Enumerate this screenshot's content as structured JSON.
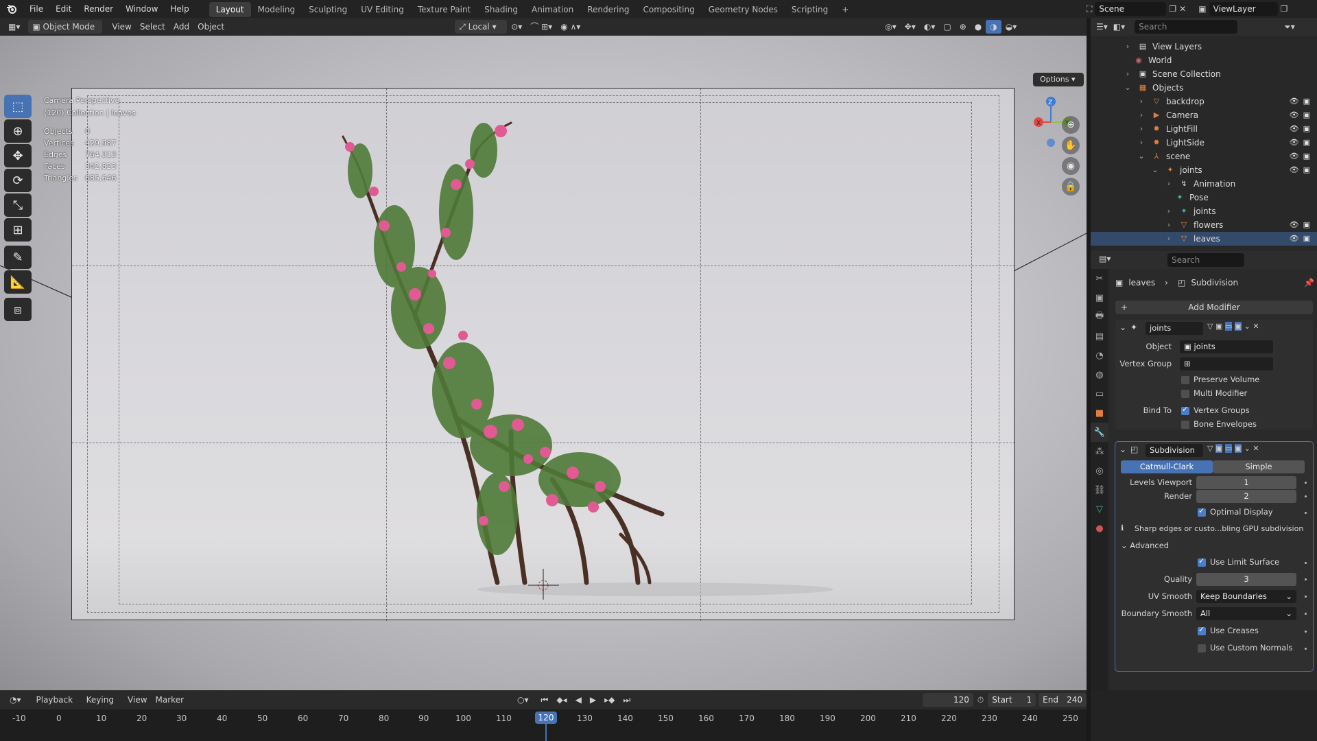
{
  "topbar": {
    "menus": [
      "File",
      "Edit",
      "Render",
      "Window",
      "Help"
    ],
    "workspaces": [
      "Layout",
      "Modeling",
      "Sculpting",
      "UV Editing",
      "Texture Paint",
      "Shading",
      "Animation",
      "Rendering",
      "Compositing",
      "Geometry Nodes",
      "Scripting"
    ],
    "add_tab": "+",
    "scene": "Scene",
    "view_layer": "ViewLayer"
  },
  "viewport_header": {
    "mode": "Object Mode",
    "menus": [
      "View",
      "Select",
      "Add",
      "Object"
    ],
    "transform_orientation": "Local",
    "options": "Options"
  },
  "overlay": {
    "line1": "Camera Perspective",
    "line2": "(120) Collection | leaves"
  },
  "stats": [
    {
      "label": "Objects",
      "value": "0"
    },
    {
      "label": "Vertices",
      "value": "429,987"
    },
    {
      "label": "Edges",
      "value": "764,313"
    },
    {
      "label": "Faces",
      "value": "342,823"
    },
    {
      "label": "Triangles",
      "value": "685,646"
    }
  ],
  "gizmo": {
    "x": "X",
    "y": "Y",
    "z": "Z"
  },
  "outliner": {
    "search_placeholder": "Search",
    "rows": [
      {
        "label": "View Layers",
        "indent": 0
      },
      {
        "label": "World",
        "indent": 0
      },
      {
        "label": "Scene Collection",
        "indent": 0
      },
      {
        "label": "Objects",
        "indent": 0
      },
      {
        "label": "backdrop",
        "indent": 1
      },
      {
        "label": "Camera",
        "indent": 1
      },
      {
        "label": "LightFill",
        "indent": 1
      },
      {
        "label": "LightSide",
        "indent": 1
      },
      {
        "label": "scene",
        "indent": 1
      },
      {
        "label": "joints",
        "indent": 2
      },
      {
        "label": "Animation",
        "indent": 3
      },
      {
        "label": "Pose",
        "indent": 3
      },
      {
        "label": "joints",
        "indent": 3
      },
      {
        "label": "flowers",
        "indent": 3
      },
      {
        "label": "leaves",
        "indent": 3
      }
    ]
  },
  "properties": {
    "search_placeholder": "Search",
    "breadcrumb_object": "leaves",
    "breadcrumb_modifier": "Subdivision",
    "add_modifier": "Add Modifier",
    "armature": {
      "name": "joints",
      "object_label": "Object",
      "object_value": "joints",
      "vgroup_label": "Vertex Group",
      "preserve_volume": "Preserve Volume",
      "multi_modifier": "Multi Modifier",
      "bind_to": "Bind To",
      "vertex_groups": "Vertex Groups",
      "bone_envelopes": "Bone Envelopes"
    },
    "subdivision": {
      "name": "Subdivision",
      "catmull": "Catmull-Clark",
      "simple": "Simple",
      "levels_viewport_label": "Levels Viewport",
      "levels_viewport": "1",
      "render_label": "Render",
      "render": "2",
      "optimal_display": "Optimal Display",
      "info": "Sharp edges or custo...bling GPU subdivision",
      "advanced": "Advanced",
      "use_limit_surface": "Use Limit Surface",
      "quality_label": "Quality",
      "quality": "3",
      "uv_smooth_label": "UV Smooth",
      "uv_smooth": "Keep Boundaries",
      "boundary_smooth_label": "Boundary Smooth",
      "boundary_smooth": "All",
      "use_creases": "Use Creases",
      "use_custom_normals": "Use Custom Normals"
    }
  },
  "timeline": {
    "menus": [
      "Playback",
      "Keying",
      "View",
      "Marker"
    ],
    "current_frame": "120",
    "start_label": "Start",
    "start": "1",
    "end_label": "End",
    "end": "240",
    "ticks": [
      "-10",
      "0",
      "10",
      "20",
      "30",
      "40",
      "50",
      "60",
      "70",
      "80",
      "90",
      "100",
      "110",
      "120",
      "130",
      "140",
      "150",
      "160",
      "170",
      "180",
      "190",
      "200",
      "210",
      "220",
      "230",
      "240",
      "250"
    ]
  }
}
